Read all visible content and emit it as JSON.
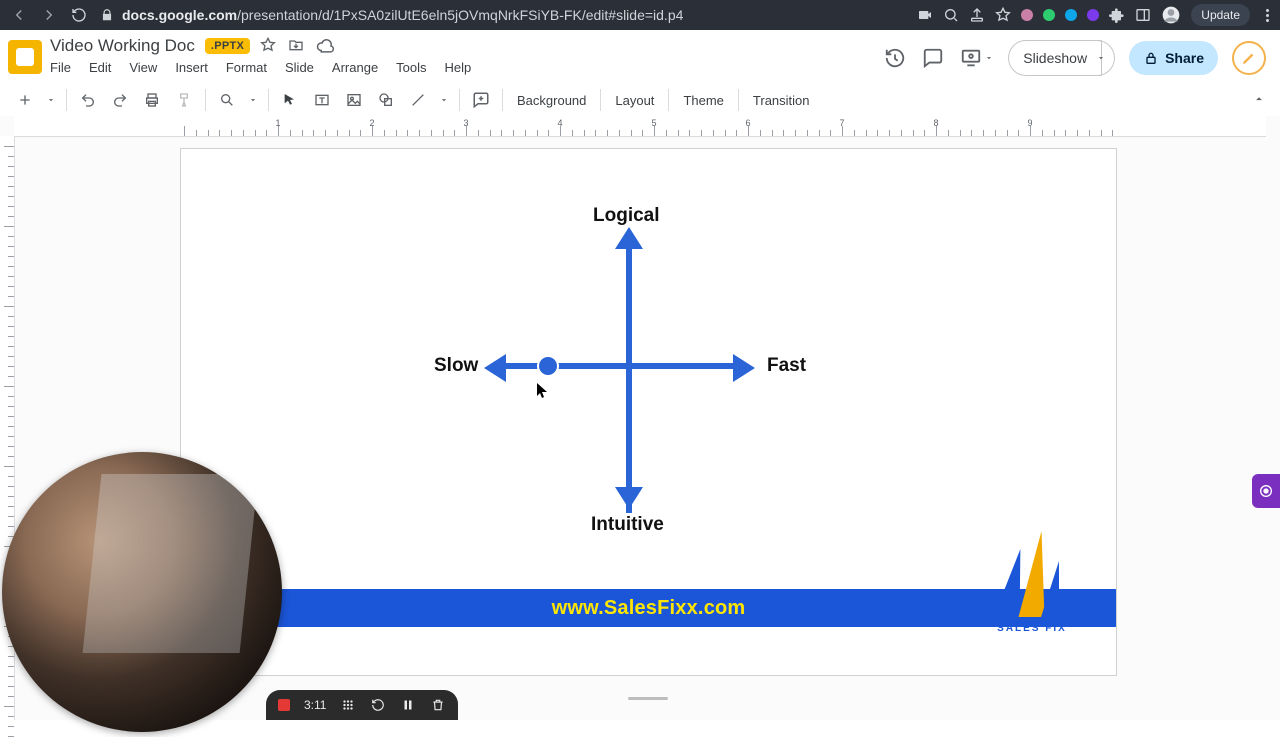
{
  "browser": {
    "host": "docs.google.com",
    "path": "/presentation/d/1PxSA0zilUtE6eln5jOVmqNrkFSiYB-FK/edit#slide=id.p4",
    "update_label": "Update"
  },
  "doc": {
    "title": "Video Working Doc",
    "badge": ".PPTX"
  },
  "menubar": [
    "File",
    "Edit",
    "View",
    "Insert",
    "Format",
    "Slide",
    "Arrange",
    "Tools",
    "Help"
  ],
  "toolbar": {
    "background": "Background",
    "layout": "Layout",
    "theme": "Theme",
    "transition": "Transition"
  },
  "actions": {
    "slideshow": "Slideshow",
    "share": "Share"
  },
  "slide": {
    "labels": {
      "top": "Logical",
      "bottom": "Intuitive",
      "left": "Slow",
      "right": "Fast"
    },
    "banner_url": "www.SalesFixx.com",
    "logo_caption": "SALES  FIX"
  },
  "recorder": {
    "time": "3:11"
  },
  "ruler": {
    "hnums": [
      "1",
      "2",
      "3",
      "4",
      "5",
      "6",
      "7",
      "8",
      "9"
    ]
  },
  "ext_dots": [
    "#c97fa7",
    "#2ecc71",
    "#0ea5e9",
    "#7c3aed"
  ]
}
